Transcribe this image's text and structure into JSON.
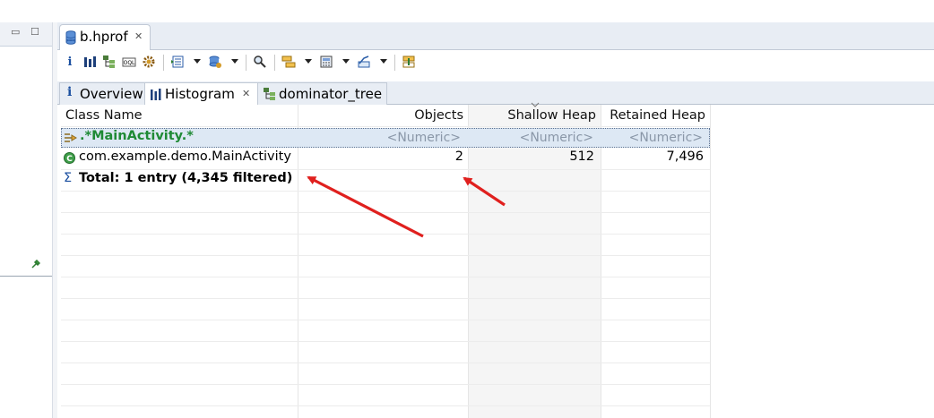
{
  "editor": {
    "file_tab": "b.hprof",
    "subtabs": [
      {
        "label": "Overview",
        "icon": "info-icon"
      },
      {
        "label": "Histogram",
        "icon": "histogram-icon"
      },
      {
        "label": "dominator_tree",
        "icon": "tree-icon"
      }
    ]
  },
  "table": {
    "columns": [
      "Class Name",
      "Objects",
      "Shallow Heap",
      "Retained Heap"
    ],
    "filter": {
      "class_regex": ".*MainActivity.*",
      "objects_placeholder": "<Numeric>",
      "shallow_placeholder": "<Numeric>",
      "retained_placeholder": "<Numeric>"
    },
    "rows": [
      {
        "class_name": "com.example.demo.MainActivity",
        "objects": "2",
        "shallow": "512",
        "retained": "7,496"
      }
    ],
    "total": "Total: 1 entry (4,345 filtered)"
  },
  "colors": {
    "accent_green": "#1f8a35",
    "annotation_red": "#e0201e",
    "tab_bar": "#e8edf4"
  }
}
